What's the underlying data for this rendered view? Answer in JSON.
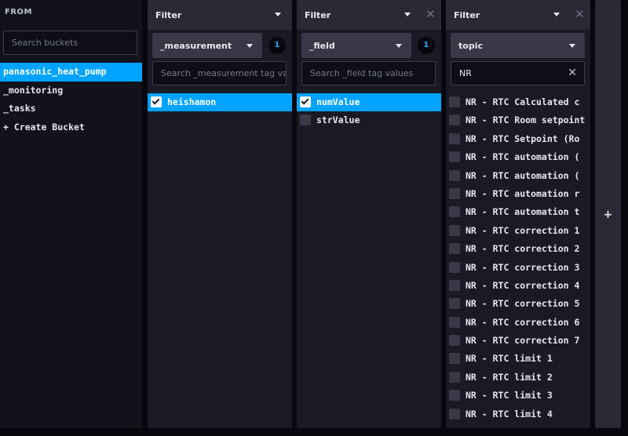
{
  "from": {
    "title": "FROM",
    "search_placeholder": "Search buckets",
    "buckets": [
      {
        "label": "panasonic_heat_pump",
        "selected": true
      },
      {
        "label": "_monitoring",
        "selected": false
      },
      {
        "label": "_tasks",
        "selected": false
      },
      {
        "label": "+ Create Bucket",
        "selected": false
      }
    ]
  },
  "filter1": {
    "title": "Filter",
    "key": "_measurement",
    "count": "1",
    "search_placeholder": "Search _measurement tag va",
    "values": [
      {
        "label": "heishamon",
        "checked": true
      }
    ]
  },
  "filter2": {
    "title": "Filter",
    "key": "_field",
    "count": "1",
    "search_placeholder": "Search _field tag values",
    "values": [
      {
        "label": "numValue",
        "checked": true
      },
      {
        "label": "strValue",
        "checked": false
      }
    ]
  },
  "filter3": {
    "title": "Filter",
    "key": "topic",
    "search_value": "NR",
    "values": [
      {
        "label": "NR - RTC Calculated c",
        "checked": false
      },
      {
        "label": "NR - RTC Room setpoint",
        "checked": false
      },
      {
        "label": "NR - RTC Setpoint (Ro",
        "checked": false
      },
      {
        "label": "NR - RTC automation (",
        "checked": false
      },
      {
        "label": "NR - RTC automation (",
        "checked": false
      },
      {
        "label": "NR - RTC automation r",
        "checked": false
      },
      {
        "label": "NR - RTC automation t",
        "checked": false
      },
      {
        "label": "NR - RTC correction 1",
        "checked": false
      },
      {
        "label": "NR - RTC correction 2",
        "checked": false
      },
      {
        "label": "NR - RTC correction 3",
        "checked": false
      },
      {
        "label": "NR - RTC correction 4",
        "checked": false
      },
      {
        "label": "NR - RTC correction 5",
        "checked": false
      },
      {
        "label": "NR - RTC correction 6",
        "checked": false
      },
      {
        "label": "NR - RTC correction 7",
        "checked": false
      },
      {
        "label": "NR - RTC limit 1",
        "checked": false
      },
      {
        "label": "NR - RTC limit 2",
        "checked": false
      },
      {
        "label": "NR - RTC limit 3",
        "checked": false
      },
      {
        "label": "NR - RTC limit 4",
        "checked": false
      }
    ]
  },
  "add_panel": {
    "label": "+"
  },
  "colors": {
    "accent": "#00a3ff",
    "panel": "#1a1a26",
    "header": "#2a2a36",
    "background": "#07070e"
  },
  "icons": {
    "close": "close-icon",
    "dropdown": "chevron-down-icon",
    "check": "check-icon",
    "clear": "clear-icon"
  }
}
